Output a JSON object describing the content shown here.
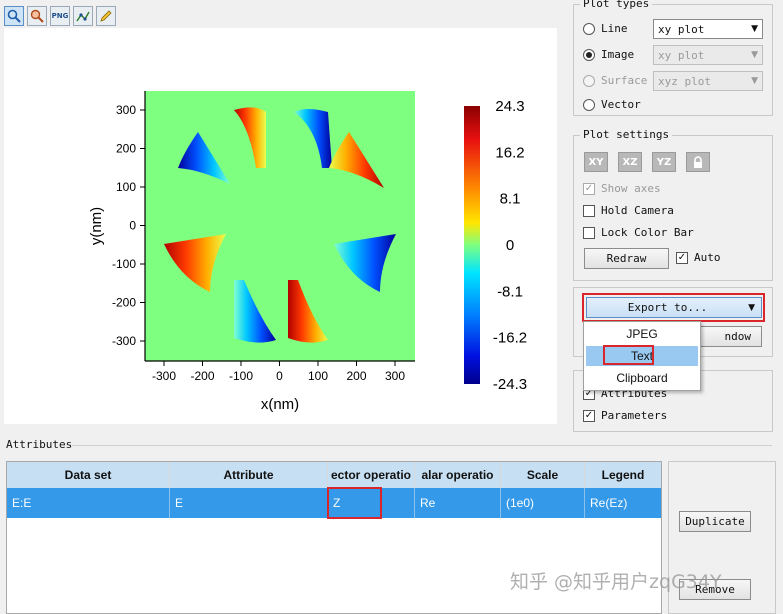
{
  "toolbar": {
    "icons": [
      "zoom-icon",
      "zoom-reset-icon",
      "png-export-icon",
      "markers-icon",
      "pencil-icon"
    ],
    "png_label": "PNG"
  },
  "plot": {
    "xlabel": "x(nm)",
    "ylabel": "y(nm)",
    "x_ticks": [
      "-300",
      "-200",
      "-100",
      "0",
      "100",
      "200",
      "300"
    ],
    "y_ticks": [
      "300",
      "200",
      "100",
      "0",
      "-100",
      "-200",
      "-300"
    ],
    "colorbar_ticks": [
      "24.3",
      "16.2",
      "8.1",
      "0",
      "-8.1",
      "-16.2",
      "-24.3"
    ],
    "colors": {
      "background": "#7fff7f",
      "max": "#8b0000",
      "min": "#00008b"
    }
  },
  "plot_types": {
    "title": "Plot types",
    "line": {
      "label": "Line",
      "combo": "xy plot"
    },
    "image": {
      "label": "Image",
      "combo": "xy plot"
    },
    "surface": {
      "label": "Surface",
      "combo": "xyz plot"
    },
    "vector": {
      "label": "Vector"
    }
  },
  "plot_settings": {
    "title": "Plot settings",
    "view_buttons": [
      "XY",
      "XZ",
      "YZ"
    ],
    "show_axes": "Show axes",
    "hold_camera": "Hold Camera",
    "lock_color_bar": "Lock Color Bar",
    "redraw": "Redraw",
    "auto": "Auto"
  },
  "export": {
    "label": "Export to...",
    "window_button_partial": "ndow",
    "menu": [
      "JPEG",
      "Text",
      "Clipboard"
    ],
    "selected": "Text"
  },
  "show_panel": {
    "attributes": "Attributes",
    "parameters": "Parameters"
  },
  "attributes": {
    "title": "Attributes",
    "columns": [
      "Data set",
      "Attribute",
      "ector operatio",
      "alar operatio",
      "Scale",
      "Legend"
    ],
    "rows": [
      {
        "dataset": "E:E",
        "attribute": "E",
        "vector_op": "Z",
        "scalar_op": "Re",
        "scale": "(1e0)",
        "legend": "Re(Ez)"
      }
    ],
    "duplicate": "Duplicate",
    "remove": "Remove"
  },
  "watermark": "知乎 @知乎用户zqG34Y"
}
